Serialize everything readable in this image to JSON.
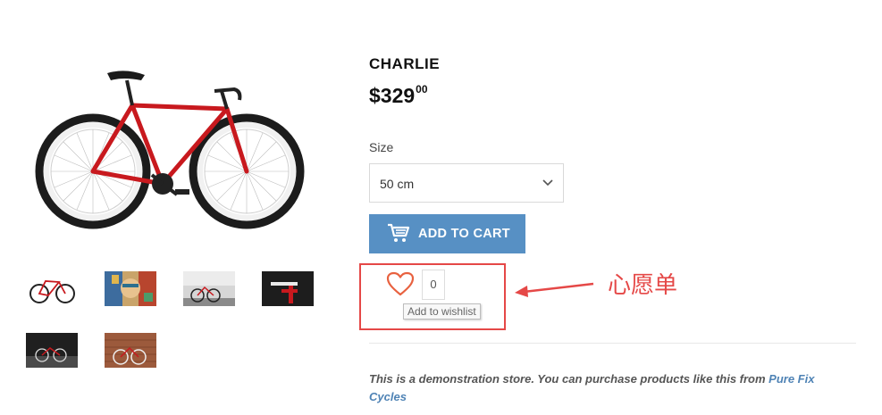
{
  "product": {
    "title": "CHARLIE",
    "price_main": "$329",
    "price_cents": "00",
    "size_label": "Size",
    "size_value": "50 cm",
    "add_to_cart": "ADD TO CART"
  },
  "wishlist": {
    "count": "0",
    "tooltip": "Add to wishlist"
  },
  "annotation": {
    "label": "心愿单",
    "color": "#e54847"
  },
  "description": {
    "text": "This is a demonstration store. You can purchase products like this from ",
    "link_text": "Pure Fix Cycles"
  },
  "colors": {
    "button": "#5790c4",
    "link": "#4f83b5",
    "bike_frame": "#c8191e",
    "annotation": "#e54847"
  },
  "icons": [
    "cart-icon",
    "heart-icon",
    "chevron-down-icon",
    "arrow-icon"
  ]
}
